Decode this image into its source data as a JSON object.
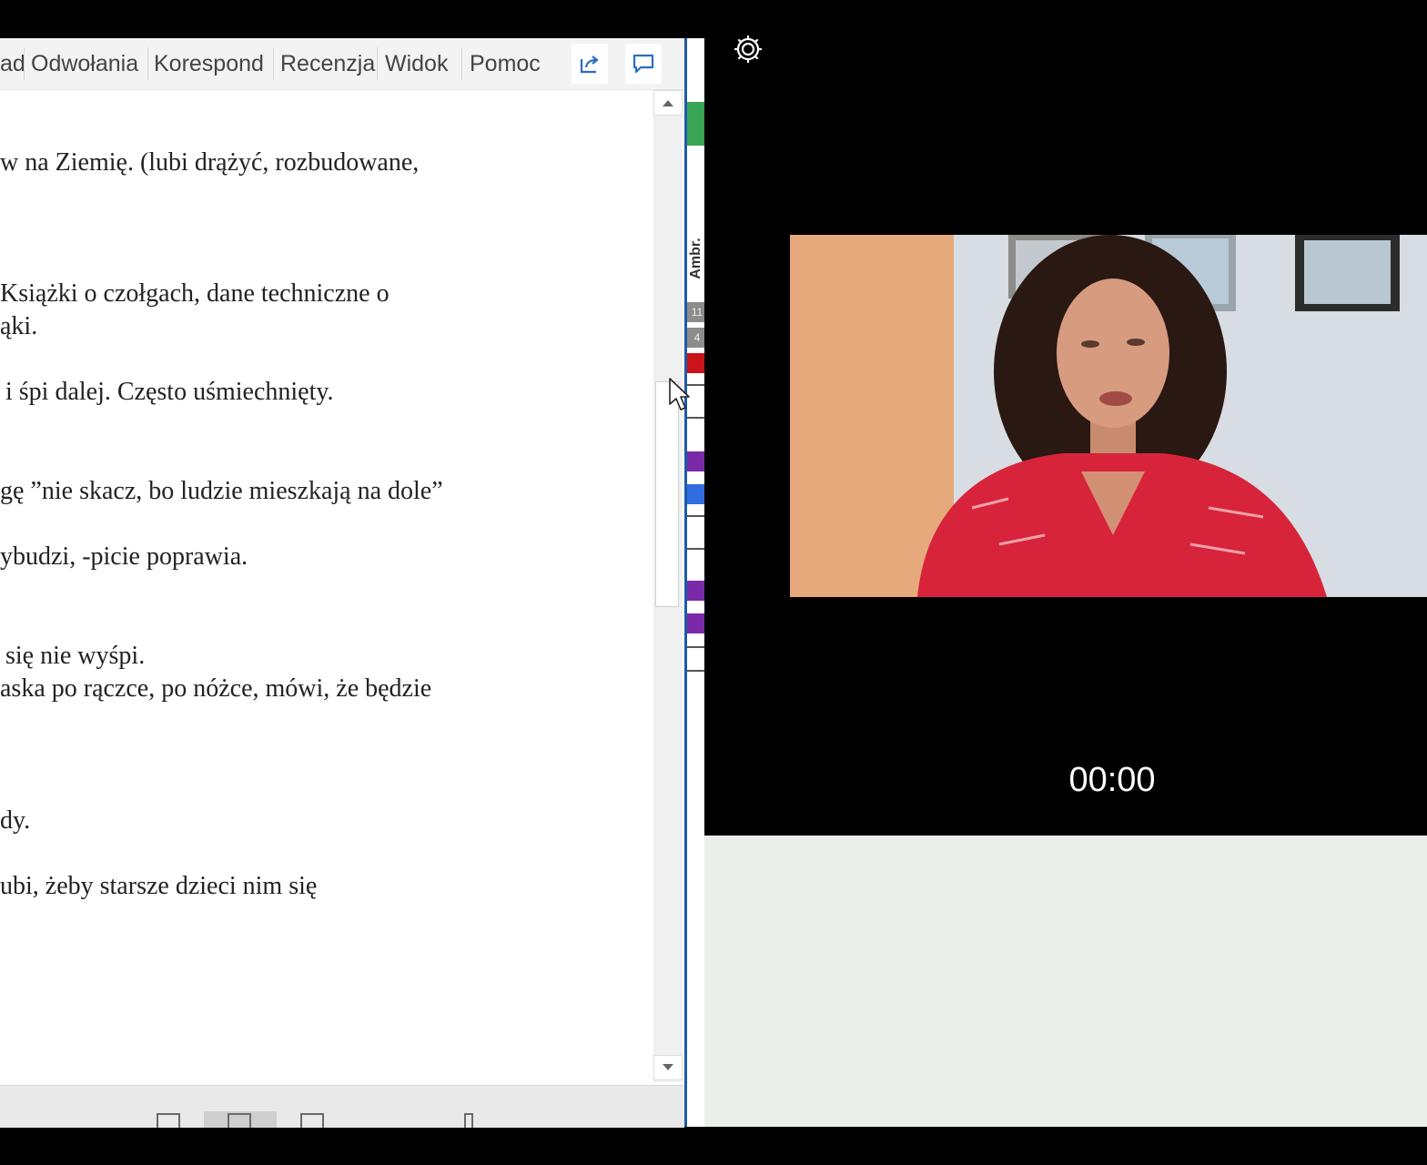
{
  "ribbon": {
    "tabs": [
      "ad",
      "Odwołania",
      "Korespond",
      "Recenzja",
      "Widok",
      "Pomoc"
    ],
    "share_icon": "share-icon",
    "comments_icon": "comment-icon"
  },
  "document": {
    "lines": [
      "w na Ziemię. (lubi drążyć, rozbudowane,",
      "Książki o czołgach, dane techniczne o",
      "ąki.",
      "i śpi dalej. Często uśmiechnięty.",
      "gę ”nie skacz, bo ludzie mieszkają na dole”",
      "ybudzi, -picie poprawia.",
      "się nie wyśpi.",
      "aska po rączce, po nóżce, mówi, że będzie",
      "dy.",
      "ubi, żeby starsze dzieci nim się"
    ]
  },
  "side_strip": {
    "label": "Ambr.",
    "numbers": [
      "11",
      "4"
    ],
    "colors": {
      "green": "#3aa655",
      "red": "#c8141a",
      "purple": "#7a2aa8",
      "blue": "#2f6de0"
    }
  },
  "video": {
    "timer": "00:00",
    "settings_icon": "gear-icon"
  }
}
